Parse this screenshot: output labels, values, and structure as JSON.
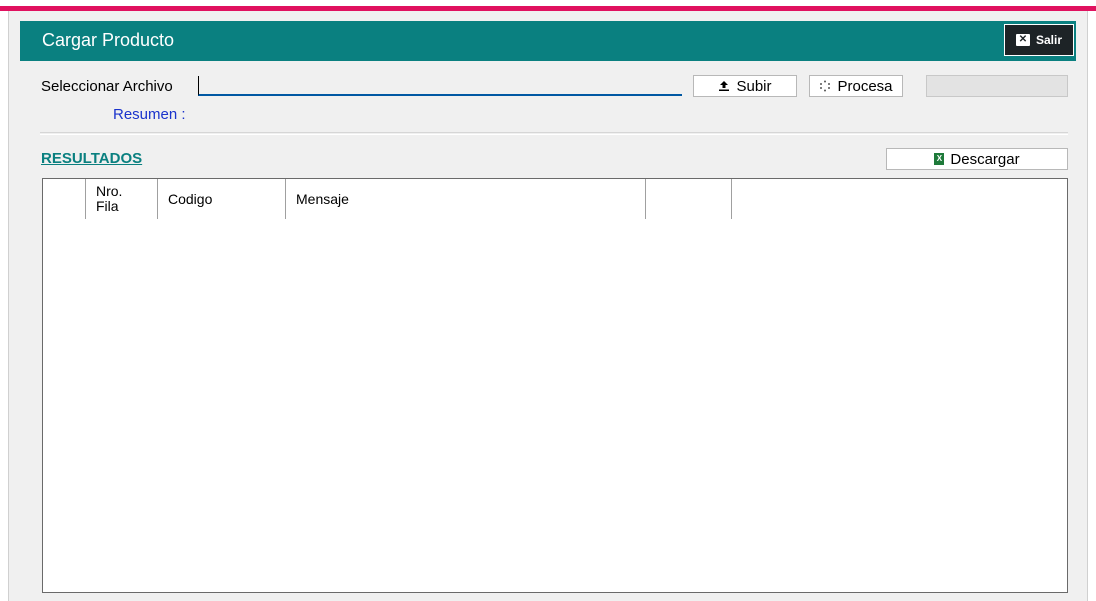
{
  "header": {
    "title": "Cargar Producto",
    "exit_label": "Salir"
  },
  "upload": {
    "label": "Seleccionar Archivo",
    "file_value": "",
    "subir_label": "Subir",
    "procesa_label": "Procesa"
  },
  "summary": {
    "label": "Resumen :"
  },
  "results": {
    "title": "RESULTADOS",
    "download_label": "Descargar",
    "columns": [
      "",
      "Nro.\nFila",
      "Codigo",
      "Mensaje",
      ""
    ],
    "rows": []
  },
  "colors": {
    "accent": "#0a8080",
    "top_line": "#e0115f",
    "summary_text": "#1a33cc"
  },
  "icons": {
    "exit": "close-square-icon",
    "upload": "upload-icon",
    "process": "spinner-icon",
    "download": "excel-icon"
  }
}
